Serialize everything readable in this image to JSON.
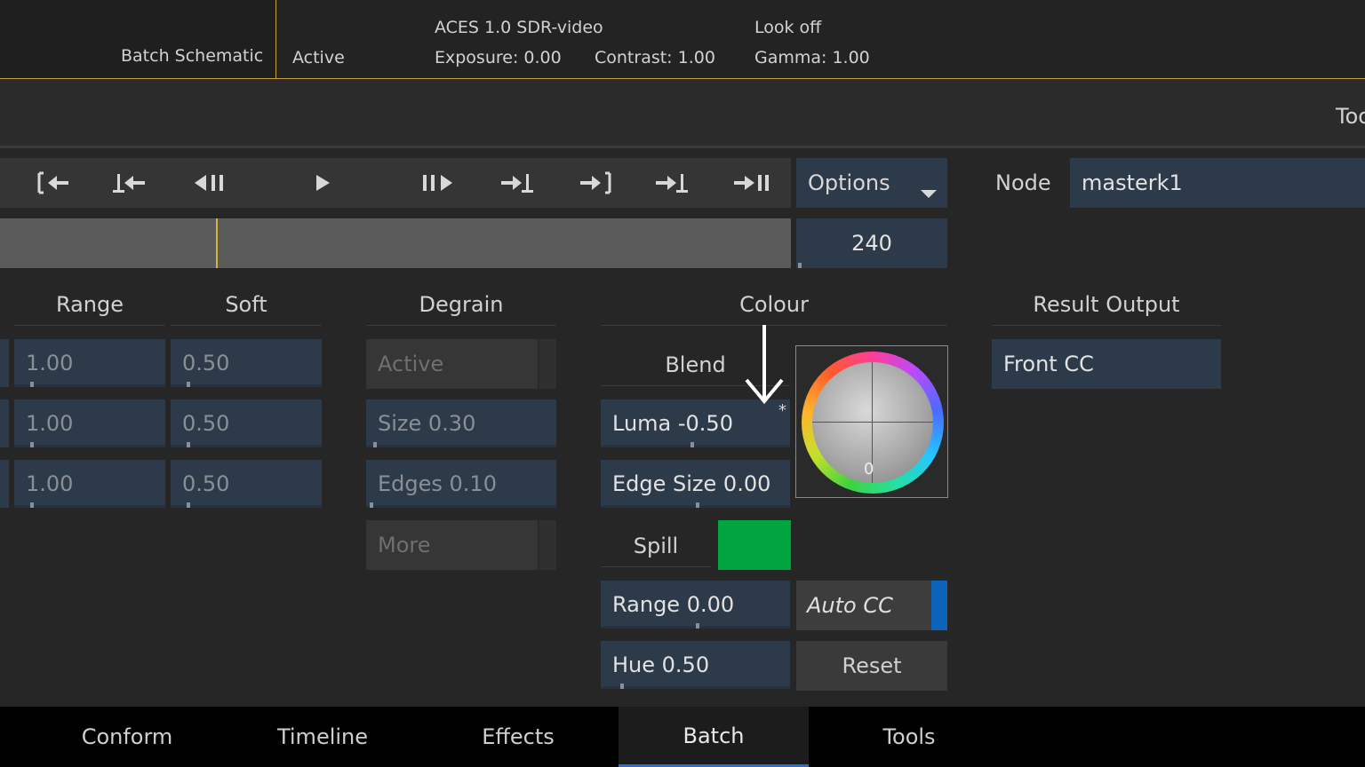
{
  "header": {
    "schematic_label": "Batch Schematic",
    "active_label": "Active",
    "colour_space": "ACES 1.0 SDR-video",
    "exposure": "Exposure: 0.00",
    "contrast": "Contrast: 1.00",
    "look": "Look off",
    "gamma": "Gamma: 1.00"
  },
  "toolbar2": {
    "tools_label": "Too"
  },
  "transport": {
    "icons": [
      "go-to-start-icon",
      "previous-keyframe-icon",
      "step-back-icon",
      "play-icon",
      "step-forward-icon",
      "next-keyframe-icon",
      "go-to-end-icon",
      "set-keyframe-icon",
      "go-to-last-frame-icon"
    ],
    "options_label": "Options",
    "frame_value": "240"
  },
  "node": {
    "label": "Node",
    "value": "masterk1"
  },
  "range_col": {
    "header": "Range",
    "values": [
      "1.00",
      "1.00",
      "1.00"
    ]
  },
  "soft_col": {
    "header": "Soft",
    "values": [
      "0.50",
      "0.50",
      "0.50"
    ]
  },
  "degrain": {
    "header": "Degrain",
    "active_label": "Active",
    "size": "Size 0.30",
    "edges": "Edges 0.10",
    "more_label": "More"
  },
  "colour": {
    "header": "Colour",
    "blend_label": "Blend",
    "luma": "Luma -0.50",
    "luma_modified_mark": "*",
    "edge_size": "Edge Size 0.00",
    "wheel_value": "0",
    "spill_label": "Spill",
    "spill_color": "#00a540",
    "range": "Range 0.00",
    "hue": "Hue 0.50",
    "auto_cc_label": "Auto CC",
    "reset_label": "Reset"
  },
  "result": {
    "header": "Result Output",
    "value": "Front CC"
  },
  "tabs": [
    {
      "label": "Conform",
      "active": false
    },
    {
      "label": "Timeline",
      "active": false
    },
    {
      "label": "Effects",
      "active": false
    },
    {
      "label": "Batch",
      "active": true
    },
    {
      "label": "Tools",
      "active": false
    }
  ],
  "colors": {
    "accent_gold": "#c9a13a",
    "accent_blue": "#2f6ec4",
    "field_navy": "#2d3a49"
  }
}
